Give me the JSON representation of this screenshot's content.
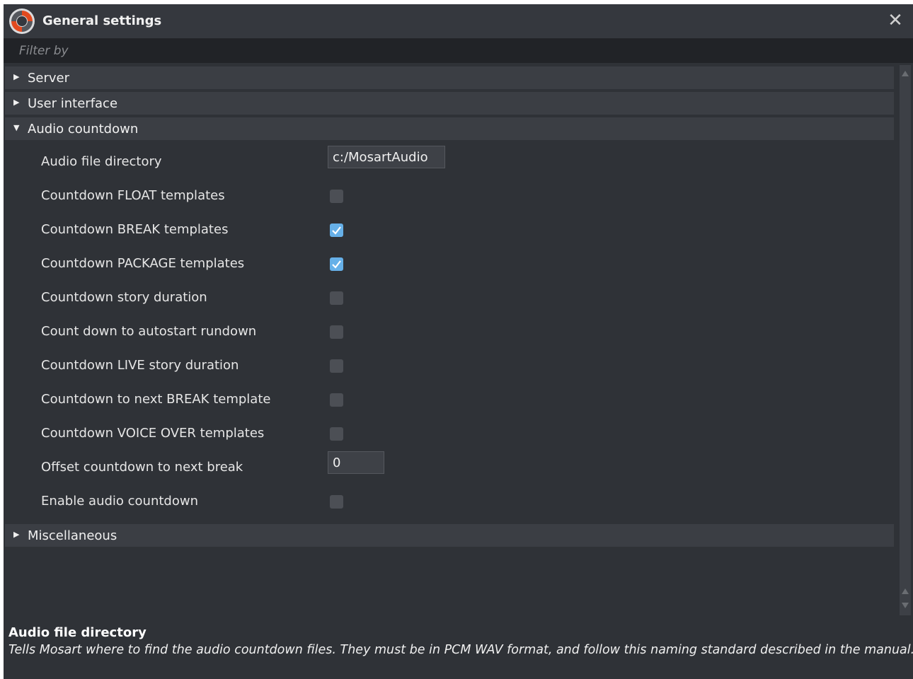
{
  "window": {
    "title": "General settings",
    "close_icon": "close-icon",
    "logo_icon": "app-logo-icon"
  },
  "filter": {
    "placeholder": "Filter by",
    "value": ""
  },
  "sections": [
    {
      "label": "Server",
      "expanded": false
    },
    {
      "label": "User interface",
      "expanded": false
    },
    {
      "label": "Audio countdown",
      "expanded": true
    },
    {
      "label": "Miscellaneous",
      "expanded": false
    }
  ],
  "audio_countdown": {
    "rows": [
      {
        "label": "Audio file directory",
        "type": "text",
        "value": "c:/MosartAudio"
      },
      {
        "label": "Countdown FLOAT templates",
        "type": "checkbox",
        "checked": false
      },
      {
        "label": "Countdown BREAK templates",
        "type": "checkbox",
        "checked": true
      },
      {
        "label": "Countdown PACKAGE templates",
        "type": "checkbox",
        "checked": true
      },
      {
        "label": "Countdown story duration",
        "type": "checkbox",
        "checked": false
      },
      {
        "label": "Count down to autostart rundown",
        "type": "checkbox",
        "checked": false
      },
      {
        "label": "Countdown LIVE story duration",
        "type": "checkbox",
        "checked": false
      },
      {
        "label": "Countdown to next BREAK template",
        "type": "checkbox",
        "checked": false
      },
      {
        "label": "Countdown VOICE OVER templates",
        "type": "checkbox",
        "checked": false
      },
      {
        "label": "Offset countdown to next break",
        "type": "text",
        "value": "0"
      },
      {
        "label": "Enable audio countdown",
        "type": "checkbox",
        "checked": false
      }
    ]
  },
  "description": {
    "title": "Audio file directory",
    "text": "Tells Mosart where to find the audio countdown files. They must be in PCM WAV format, and follow this naming standard described in the manual."
  },
  "colors": {
    "background": "#2f3237",
    "section_header": "#3b3e44",
    "checkbox_checked": "#66b0e8",
    "logo_accent": "#e24a1f"
  }
}
